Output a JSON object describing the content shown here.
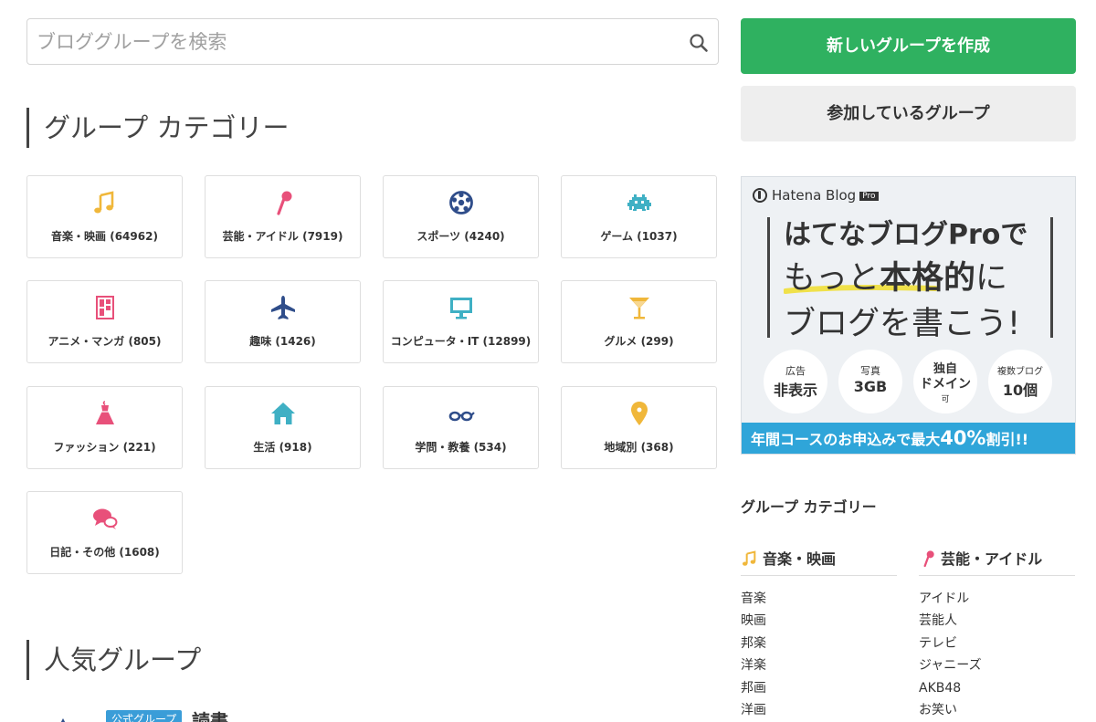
{
  "search": {
    "placeholder": "ブロググループを検索"
  },
  "categories_heading": "グループ カテゴリー",
  "categories": [
    {
      "label": "音楽・映画 (64962)",
      "icon": "music-note-icon"
    },
    {
      "label": "芸能・アイドル (7919)",
      "icon": "microphone-icon"
    },
    {
      "label": "スポーツ (4240)",
      "icon": "soccer-ball-icon"
    },
    {
      "label": "ゲーム (1037)",
      "icon": "space-invader-icon"
    },
    {
      "label": "アニメ・マンガ (805)",
      "icon": "manga-book-icon"
    },
    {
      "label": "趣味 (1426)",
      "icon": "airplane-icon"
    },
    {
      "label": "コンピュータ・IT (12899)",
      "icon": "monitor-icon"
    },
    {
      "label": "グルメ (299)",
      "icon": "cocktail-glass-icon"
    },
    {
      "label": "ファッション (221)",
      "icon": "dress-icon"
    },
    {
      "label": "生活 (918)",
      "icon": "house-icon"
    },
    {
      "label": "学問・教養 (534)",
      "icon": "glasses-icon"
    },
    {
      "label": "地域別 (368)",
      "icon": "map-pin-icon"
    },
    {
      "label": "日記・その他 (1608)",
      "icon": "speech-bubbles-icon"
    }
  ],
  "popular_heading": "人気グループ",
  "popular": {
    "badge": "公式グループ",
    "name": "読書"
  },
  "side": {
    "create_button": "新しいグループを作成",
    "joined_button": "参加しているグループ",
    "promo": {
      "logo": "Hatena Blog",
      "logo_badge": "Pro",
      "line1": "はてなブログProで",
      "line2_a": "もっと",
      "line2_b": "本格的",
      "line2_c": "に",
      "line3": "ブログを書こう!",
      "features": [
        {
          "top": "広告",
          "bottom": "非表示"
        },
        {
          "top": "写真",
          "bottom": "3GB"
        },
        {
          "top": "独自",
          "bottom": "ドメイン",
          "sub": "可"
        },
        {
          "top": "複数ブログ",
          "bottom": "10個"
        }
      ],
      "footer_a": "年間コースのお申込みで最大",
      "footer_b": "40%",
      "footer_c": "割引!!"
    },
    "category_title": "グループ カテゴリー",
    "columns": [
      {
        "title": "音楽・映画",
        "icon": "music-note-icon",
        "items": [
          "音楽",
          "映画",
          "邦楽",
          "洋楽",
          "邦画",
          "洋画"
        ]
      },
      {
        "title": "芸能・アイドル",
        "icon": "microphone-icon",
        "items": [
          "アイドル",
          "芸能人",
          "テレビ",
          "ジャニーズ",
          "AKB48",
          "お笑い"
        ]
      }
    ]
  },
  "colors": {
    "primary_green": "#2fb160",
    "promo_blue": "#2fa5d9",
    "icon_yellow": "#f0b73a",
    "icon_pink": "#e8507a",
    "icon_navy": "#2f4d8a",
    "icon_teal": "#3fb0c4"
  }
}
